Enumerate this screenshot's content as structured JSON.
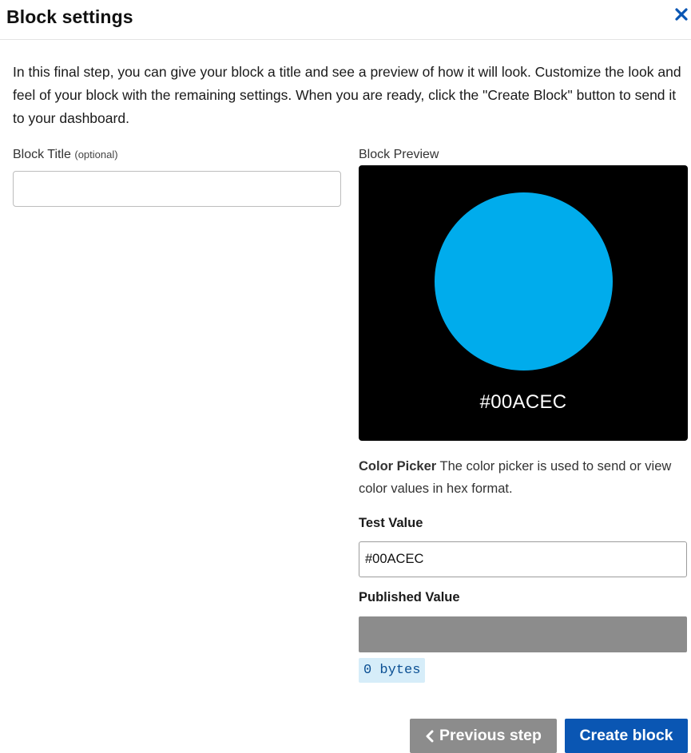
{
  "header": {
    "title": "Block settings",
    "close_icon": "close-icon"
  },
  "intro_text": "In this final step, you can give your block a title and see a preview of how it will look. Customize the look and feel of your block with the remaining settings. When you are ready, click the \"Create Block\" button to send it to your dashboard.",
  "block_title": {
    "label": "Block Title",
    "optional_note": "(optional)",
    "value": ""
  },
  "preview": {
    "label": "Block Preview",
    "background_color": "#000000",
    "circle_color": "#00ACEC",
    "hex_text": "#00ACEC"
  },
  "color_picker": {
    "name": "Color Picker",
    "description": "The color picker is used to send or view color values in hex format."
  },
  "test_value": {
    "label": "Test Value",
    "value": "#00ACEC"
  },
  "published_value": {
    "label": "Published Value",
    "value": "",
    "size_badge": "0 bytes"
  },
  "footer": {
    "previous_label": "Previous step",
    "create_label": "Create block"
  },
  "colors": {
    "accent": "#0a56b3",
    "muted_button": "#8c8c8c",
    "badge_bg": "#d6edf9",
    "badge_text": "#0a4f93"
  }
}
